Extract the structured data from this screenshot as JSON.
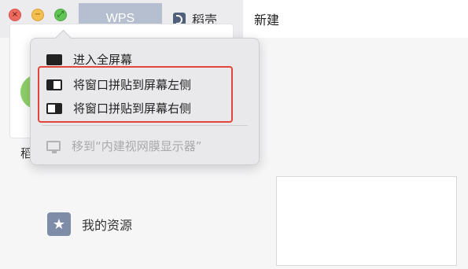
{
  "window": {
    "controls": {
      "close_glyph": "×",
      "minimize_glyph": "−",
      "maximize_glyph": "⤢"
    }
  },
  "tabs": {
    "wps": "WPS",
    "daoke": "稻壳",
    "new": "新建"
  },
  "content": {
    "fragment_label": "稻",
    "resources_label": "我的资源",
    "resources_icon": "star-icon"
  },
  "menu": {
    "items": [
      {
        "label": "进入全屏幕",
        "icon": "fullscreen-icon",
        "enabled": true
      },
      {
        "label": "将窗口拼贴到屏幕左侧",
        "icon": "tile-left-icon",
        "enabled": true
      },
      {
        "label": "将窗口拼贴到屏幕右侧",
        "icon": "tile-right-icon",
        "enabled": true
      },
      {
        "label": "移到“内建视网膜显示器”",
        "icon": "display-icon",
        "enabled": false
      }
    ]
  },
  "colors": {
    "highlight": "#e0463a",
    "wps_tab": "#b6bfcf",
    "close": "#ed6a5e",
    "minimize": "#f5bf4f",
    "maximize": "#61c454"
  }
}
